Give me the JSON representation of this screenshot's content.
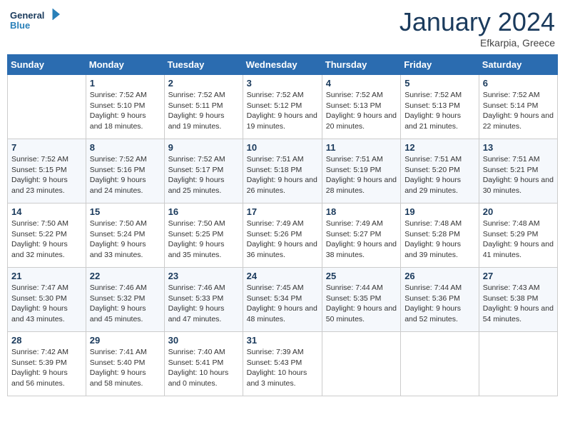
{
  "logo": {
    "line1": "General",
    "line2": "Blue"
  },
  "title": "January 2024",
  "location": "Efkarpia, Greece",
  "weekdays": [
    "Sunday",
    "Monday",
    "Tuesday",
    "Wednesday",
    "Thursday",
    "Friday",
    "Saturday"
  ],
  "weeks": [
    [
      {
        "num": "",
        "sunrise": "",
        "sunset": "",
        "daylight": ""
      },
      {
        "num": "1",
        "sunrise": "Sunrise: 7:52 AM",
        "sunset": "Sunset: 5:10 PM",
        "daylight": "Daylight: 9 hours and 18 minutes."
      },
      {
        "num": "2",
        "sunrise": "Sunrise: 7:52 AM",
        "sunset": "Sunset: 5:11 PM",
        "daylight": "Daylight: 9 hours and 19 minutes."
      },
      {
        "num": "3",
        "sunrise": "Sunrise: 7:52 AM",
        "sunset": "Sunset: 5:12 PM",
        "daylight": "Daylight: 9 hours and 19 minutes."
      },
      {
        "num": "4",
        "sunrise": "Sunrise: 7:52 AM",
        "sunset": "Sunset: 5:13 PM",
        "daylight": "Daylight: 9 hours and 20 minutes."
      },
      {
        "num": "5",
        "sunrise": "Sunrise: 7:52 AM",
        "sunset": "Sunset: 5:13 PM",
        "daylight": "Daylight: 9 hours and 21 minutes."
      },
      {
        "num": "6",
        "sunrise": "Sunrise: 7:52 AM",
        "sunset": "Sunset: 5:14 PM",
        "daylight": "Daylight: 9 hours and 22 minutes."
      }
    ],
    [
      {
        "num": "7",
        "sunrise": "Sunrise: 7:52 AM",
        "sunset": "Sunset: 5:15 PM",
        "daylight": "Daylight: 9 hours and 23 minutes."
      },
      {
        "num": "8",
        "sunrise": "Sunrise: 7:52 AM",
        "sunset": "Sunset: 5:16 PM",
        "daylight": "Daylight: 9 hours and 24 minutes."
      },
      {
        "num": "9",
        "sunrise": "Sunrise: 7:52 AM",
        "sunset": "Sunset: 5:17 PM",
        "daylight": "Daylight: 9 hours and 25 minutes."
      },
      {
        "num": "10",
        "sunrise": "Sunrise: 7:51 AM",
        "sunset": "Sunset: 5:18 PM",
        "daylight": "Daylight: 9 hours and 26 minutes."
      },
      {
        "num": "11",
        "sunrise": "Sunrise: 7:51 AM",
        "sunset": "Sunset: 5:19 PM",
        "daylight": "Daylight: 9 hours and 28 minutes."
      },
      {
        "num": "12",
        "sunrise": "Sunrise: 7:51 AM",
        "sunset": "Sunset: 5:20 PM",
        "daylight": "Daylight: 9 hours and 29 minutes."
      },
      {
        "num": "13",
        "sunrise": "Sunrise: 7:51 AM",
        "sunset": "Sunset: 5:21 PM",
        "daylight": "Daylight: 9 hours and 30 minutes."
      }
    ],
    [
      {
        "num": "14",
        "sunrise": "Sunrise: 7:50 AM",
        "sunset": "Sunset: 5:22 PM",
        "daylight": "Daylight: 9 hours and 32 minutes."
      },
      {
        "num": "15",
        "sunrise": "Sunrise: 7:50 AM",
        "sunset": "Sunset: 5:24 PM",
        "daylight": "Daylight: 9 hours and 33 minutes."
      },
      {
        "num": "16",
        "sunrise": "Sunrise: 7:50 AM",
        "sunset": "Sunset: 5:25 PM",
        "daylight": "Daylight: 9 hours and 35 minutes."
      },
      {
        "num": "17",
        "sunrise": "Sunrise: 7:49 AM",
        "sunset": "Sunset: 5:26 PM",
        "daylight": "Daylight: 9 hours and 36 minutes."
      },
      {
        "num": "18",
        "sunrise": "Sunrise: 7:49 AM",
        "sunset": "Sunset: 5:27 PM",
        "daylight": "Daylight: 9 hours and 38 minutes."
      },
      {
        "num": "19",
        "sunrise": "Sunrise: 7:48 AM",
        "sunset": "Sunset: 5:28 PM",
        "daylight": "Daylight: 9 hours and 39 minutes."
      },
      {
        "num": "20",
        "sunrise": "Sunrise: 7:48 AM",
        "sunset": "Sunset: 5:29 PM",
        "daylight": "Daylight: 9 hours and 41 minutes."
      }
    ],
    [
      {
        "num": "21",
        "sunrise": "Sunrise: 7:47 AM",
        "sunset": "Sunset: 5:30 PM",
        "daylight": "Daylight: 9 hours and 43 minutes."
      },
      {
        "num": "22",
        "sunrise": "Sunrise: 7:46 AM",
        "sunset": "Sunset: 5:32 PM",
        "daylight": "Daylight: 9 hours and 45 minutes."
      },
      {
        "num": "23",
        "sunrise": "Sunrise: 7:46 AM",
        "sunset": "Sunset: 5:33 PM",
        "daylight": "Daylight: 9 hours and 47 minutes."
      },
      {
        "num": "24",
        "sunrise": "Sunrise: 7:45 AM",
        "sunset": "Sunset: 5:34 PM",
        "daylight": "Daylight: 9 hours and 48 minutes."
      },
      {
        "num": "25",
        "sunrise": "Sunrise: 7:44 AM",
        "sunset": "Sunset: 5:35 PM",
        "daylight": "Daylight: 9 hours and 50 minutes."
      },
      {
        "num": "26",
        "sunrise": "Sunrise: 7:44 AM",
        "sunset": "Sunset: 5:36 PM",
        "daylight": "Daylight: 9 hours and 52 minutes."
      },
      {
        "num": "27",
        "sunrise": "Sunrise: 7:43 AM",
        "sunset": "Sunset: 5:38 PM",
        "daylight": "Daylight: 9 hours and 54 minutes."
      }
    ],
    [
      {
        "num": "28",
        "sunrise": "Sunrise: 7:42 AM",
        "sunset": "Sunset: 5:39 PM",
        "daylight": "Daylight: 9 hours and 56 minutes."
      },
      {
        "num": "29",
        "sunrise": "Sunrise: 7:41 AM",
        "sunset": "Sunset: 5:40 PM",
        "daylight": "Daylight: 9 hours and 58 minutes."
      },
      {
        "num": "30",
        "sunrise": "Sunrise: 7:40 AM",
        "sunset": "Sunset: 5:41 PM",
        "daylight": "Daylight: 10 hours and 0 minutes."
      },
      {
        "num": "31",
        "sunrise": "Sunrise: 7:39 AM",
        "sunset": "Sunset: 5:43 PM",
        "daylight": "Daylight: 10 hours and 3 minutes."
      },
      {
        "num": "",
        "sunrise": "",
        "sunset": "",
        "daylight": ""
      },
      {
        "num": "",
        "sunrise": "",
        "sunset": "",
        "daylight": ""
      },
      {
        "num": "",
        "sunrise": "",
        "sunset": "",
        "daylight": ""
      }
    ]
  ]
}
